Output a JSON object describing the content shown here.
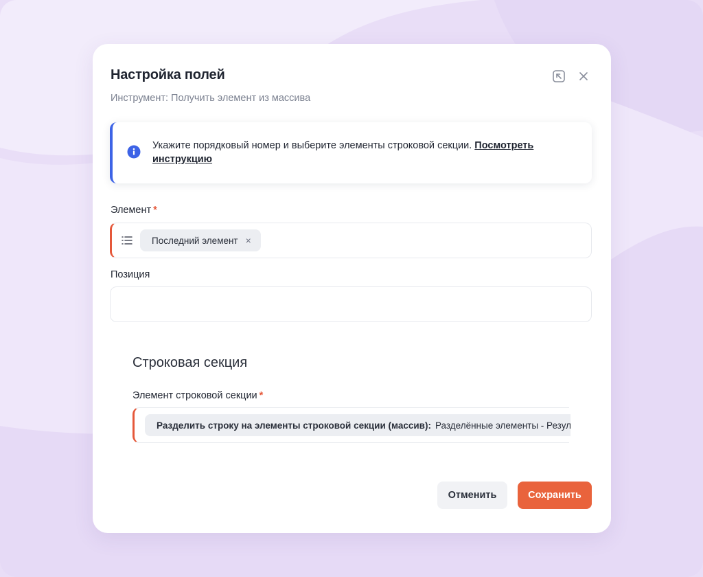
{
  "dialog": {
    "title": "Настройка полей",
    "subtitle": "Инструмент: Получить элемент из массива"
  },
  "info": {
    "text": "Укажите порядковый номер и выберите элементы строковой секции. ",
    "link": "Посмотреть инструкцию",
    "accent_color": "#3d63e6"
  },
  "element_field": {
    "label": "Элемент",
    "required_mark": "*",
    "chip": "Последний элемент",
    "chip_remove": "×"
  },
  "position_field": {
    "label": "Позиция",
    "value": ""
  },
  "row_section": {
    "title": "Строковая секция",
    "label": "Элемент строковой секции",
    "required_mark": "*",
    "chip_bold": "Разделить строку на элементы строковой секции (массив):",
    "chip_rest": "Разделённые элементы - Результат"
  },
  "buttons": {
    "cancel": "Отменить",
    "save": "Сохранить"
  },
  "colors": {
    "primary": "#e9633c",
    "error": "#e5583a",
    "background": "#e9def7"
  }
}
